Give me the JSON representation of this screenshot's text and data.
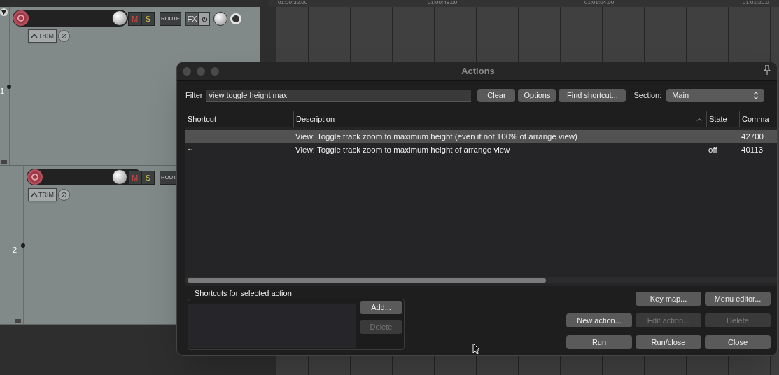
{
  "timeline": {
    "labels": [
      "01:00:32.00",
      "01:00:48.00",
      "01:01:04.00",
      "01:01:20.0"
    ]
  },
  "tracks": [
    {
      "number": "1",
      "buttons": [
        "M",
        "S",
        "ROUTE"
      ],
      "fx": "FX",
      "trim": "TRIM"
    },
    {
      "number": "2",
      "buttons": [
        "M",
        "S",
        "ROUT"
      ],
      "trim": "TRIM"
    }
  ],
  "dialog": {
    "title": "Actions",
    "filter_label": "Filter",
    "filter_value": "view toggle height max",
    "top_buttons": [
      "Clear",
      "Options",
      "Find shortcut..."
    ],
    "section_label": "Section:",
    "section_value": "Main",
    "columns": [
      "Shortcut",
      "Description",
      "State",
      "Comma"
    ],
    "rows": [
      {
        "shortcut": "",
        "description": "View: Toggle track zoom to maximum height (even if not 100% of arrange view)",
        "state": "",
        "command": "42700",
        "selected": true
      },
      {
        "shortcut": "~",
        "description": "View: Toggle track zoom to maximum height of arrange view",
        "state": "off",
        "command": "40113",
        "selected": false
      }
    ],
    "shortcuts_title": "Shortcuts for selected action",
    "shortcut_buttons": [
      {
        "label": "Add...",
        "disabled": false
      },
      {
        "label": "Delete",
        "disabled": true
      }
    ],
    "button_rows": [
      [
        {
          "label": "Key map...",
          "disabled": false
        },
        {
          "label": "Menu editor...",
          "disabled": false
        }
      ],
      [
        {
          "label": "New action...",
          "disabled": false
        },
        {
          "label": "Edit action...",
          "disabled": true
        },
        {
          "label": "Delete",
          "disabled": true
        }
      ],
      [
        {
          "label": "Run",
          "disabled": false
        },
        {
          "label": "Run/close",
          "disabled": false
        },
        {
          "label": "Close",
          "disabled": false
        }
      ]
    ]
  }
}
